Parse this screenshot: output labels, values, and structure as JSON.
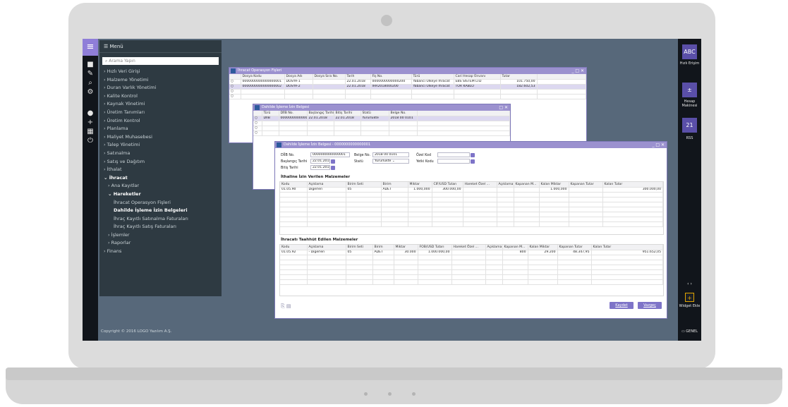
{
  "menu": {
    "title": "Menü",
    "search_placeholder": "Arama Yapın",
    "items": [
      "Hızlı Veri Girişi",
      "Malzeme Yönetimi",
      "Duran Varlık Yönetimi",
      "Kalite Kontrol",
      "Kaynak Yönetimi",
      "Üretim Tanımları",
      "Üretim Kontrol",
      "Planlama",
      "Maliyet Muhasebesi",
      "Talep Yönetimi",
      "Satınalma",
      "Satış ve Dağıtım",
      "İthalat",
      "İhracat",
      "Ana Kayıtlar",
      "Hareketler",
      "İhracat Operasyon Fişleri",
      "Dahilde İşleme İzin Belgeleri",
      "İhraç Kayıtlı Satınalma Faturaları",
      "İhraç Kayıtlı Satış Faturaları",
      "İşlemler",
      "Raporlar",
      "Finans"
    ]
  },
  "copyright": "Copyright © 2016 LOGO Yazılım A.Ş.",
  "right_rail": {
    "quick_access": "Hızlı Erişim",
    "calculator": "Hesap Makinesi",
    "rss": "RSS",
    "widget_add": "Widget Ekle",
    "general": "GENEL",
    "calendar_day": "21"
  },
  "win1": {
    "title": "İhracat Operasyon Fişleri",
    "columns": [
      "Dosya Kodu",
      "Dosya Adı",
      "Dosya Sıra No.",
      "Tarih",
      "Fiş No.",
      "Türü",
      "Cari Hesap Ünvanı",
      "Tutar"
    ],
    "rows": [
      [
        "0000000000000000001",
        "DOSYA-1",
        "",
        "22.01.2018",
        "0000000000000200",
        "Yabancı Ülkeye İhracat",
        "EBS SİSTEM LTD",
        "101.750,00"
      ],
      [
        "0000000000000000002",
        "DOSYA-2",
        "",
        "22.01.2018",
        "İHR2018000200",
        "Yabancı Ülkeye İhracat",
        "TOR KABLO",
        "182.602,53"
      ]
    ]
  },
  "win2": {
    "title": "Dahilde İşleme İzin Belgesi",
    "columns": [
      "Türü",
      "DİİB No.",
      "Başlangıç Tarihi",
      "Bitiş Tarihi",
      "Statü",
      "Belge No."
    ],
    "rows": [
      [
        "DİİB",
        "0000000000000001",
        "22.01.2018",
        "22.01.2018",
        "Yürürlükte",
        "2018 00 0101"
      ]
    ]
  },
  "win3": {
    "title": "Dahilde İşleme İzin Belgesi - 0000000000000001",
    "labels": {
      "diib_no": "DİİB No.",
      "start": "Başlangıç Tarihi",
      "end": "Bitiş Tarihi",
      "belge_no": "Belge No.",
      "status": "Statü",
      "ozel_kod": "Özel Kod",
      "yetki_kodu": "Yetki Kodu"
    },
    "values": {
      "diib_no": "0000000000000001",
      "start": "22.01.2018",
      "end": "22.01.2018",
      "belge_no": "2018 00 0101",
      "status": "Yürürlükte"
    },
    "import_title": "İthaline İzin Verilen Malzemeler",
    "import_columns": [
      "Kodu",
      "Açıklama",
      "Birim Seti",
      "Birim",
      "Miktar",
      "CIF/USD Tutarı",
      "Hareket Özel ...",
      "Açıklama",
      "Kapanan M...",
      "Kalan Miktar",
      "Kapanan Tutar",
      "Kalan Tutar"
    ],
    "import_rows": [
      [
        "01.05.90",
        "Diğerleri",
        "05",
        "ADET",
        "1.000,000",
        "300.000,00",
        "",
        "",
        "",
        "1.000,000",
        "",
        "300.000,00"
      ]
    ],
    "export_title": "İhracatı Taahhüt Edilen Malzemeler",
    "export_columns": [
      "Kodu",
      "Açıklama",
      "Birim Seti",
      "Birim",
      "Miktar",
      "FOB/USD Tutarı",
      "Hareket Özel ...",
      "Açıklama",
      "Kapanan M...",
      "Kalan Miktar",
      "Kapanan Tutar",
      "Kalan Tutar"
    ],
    "export_rows": [
      [
        "01.05.92",
        "- Diğerleri",
        "05",
        "ADET",
        "30.000",
        "1.000.000,00",
        "",
        "",
        "800",
        "29.200",
        "48.347,95",
        "951.652,05"
      ]
    ],
    "save": "Kaydet",
    "cancel": "Vazgeç"
  }
}
